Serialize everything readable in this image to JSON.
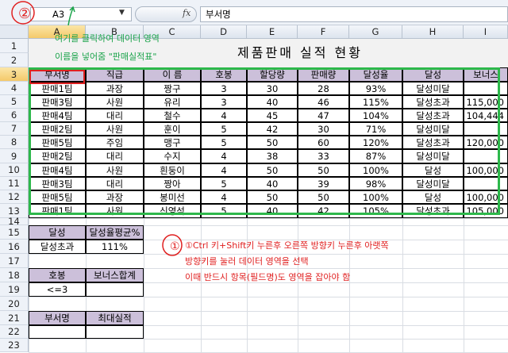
{
  "formula_bar": {
    "name_box": "A3",
    "fx": "fx",
    "formula": "부서명"
  },
  "columns": [
    "A",
    "B",
    "C",
    "D",
    "E",
    "F",
    "G",
    "H",
    "I"
  ],
  "rows": [
    "1",
    "2",
    "3",
    "4",
    "5",
    "6",
    "7",
    "8",
    "9",
    "10",
    "11",
    "12",
    "13",
    "14",
    "15",
    "16",
    "17",
    "18",
    "19",
    "20",
    "21",
    "22",
    "23"
  ],
  "title": "제품판매 실적 현황",
  "annotations": {
    "marker_1": "①",
    "marker_2": "②",
    "note_top_line1": "여기를 클릭하여 데이터 영역",
    "note_top_line2": "이름을 넣어줌 \"판매실적표\"",
    "note_bottom_line1": "①Ctrl 키+Shift키 누른후 오른쪽 방향키 누른후 아랫쪽",
    "note_bottom_line2": "방향키를 눌러 데이터 영역을 선택",
    "note_bottom_line3": "이때 반드시 항목(필드명)도 영역을 잡아야 함"
  },
  "table": {
    "headers": [
      "부서명",
      "직급",
      "이 름",
      "호봉",
      "할당량",
      "판매량",
      "달성율",
      "달성",
      "보너스"
    ],
    "rows": [
      [
        "판매1팀",
        "과장",
        "짱구",
        "3",
        "30",
        "28",
        "93%",
        "달성미달",
        ""
      ],
      [
        "판매3팀",
        "사원",
        "유리",
        "3",
        "40",
        "46",
        "115%",
        "달성초과",
        "115,000"
      ],
      [
        "판매4팀",
        "대리",
        "철수",
        "4",
        "45",
        "47",
        "104%",
        "달성초과",
        "104,444"
      ],
      [
        "판매2팀",
        "사원",
        "훈이",
        "5",
        "42",
        "30",
        "71%",
        "달성미달",
        ""
      ],
      [
        "판매5팀",
        "주임",
        "맹구",
        "5",
        "50",
        "60",
        "120%",
        "달성초과",
        "120,000"
      ],
      [
        "판매2팀",
        "대리",
        "수지",
        "4",
        "38",
        "33",
        "87%",
        "달성미달",
        ""
      ],
      [
        "판매4팀",
        "사원",
        "흰둥이",
        "4",
        "50",
        "50",
        "100%",
        "달성",
        "100,000"
      ],
      [
        "판매3팀",
        "대리",
        "짱아",
        "5",
        "40",
        "39",
        "98%",
        "달성미달",
        ""
      ],
      [
        "판매5팀",
        "과장",
        "봉미선",
        "4",
        "50",
        "50",
        "100%",
        "달성",
        "100,000"
      ],
      [
        "판매1팀",
        "사원",
        "신영석",
        "5",
        "40",
        "42",
        "105%",
        "달성초과",
        "105,000"
      ]
    ]
  },
  "criteria1": {
    "headers": [
      "달성",
      "달성율평균%"
    ],
    "values": [
      "달성초과",
      "111%"
    ]
  },
  "criteria2": {
    "headers": [
      "호봉",
      "보너스합계"
    ],
    "values": [
      "<=3",
      ""
    ]
  },
  "criteria3": {
    "headers": [
      "부서명",
      "최대실적"
    ],
    "values": [
      "",
      ""
    ]
  },
  "colors": {
    "header_fill": "#ccc0da",
    "green_box": "#2db84b",
    "red_note": "#e02020",
    "green_note": "#1aa34a"
  }
}
